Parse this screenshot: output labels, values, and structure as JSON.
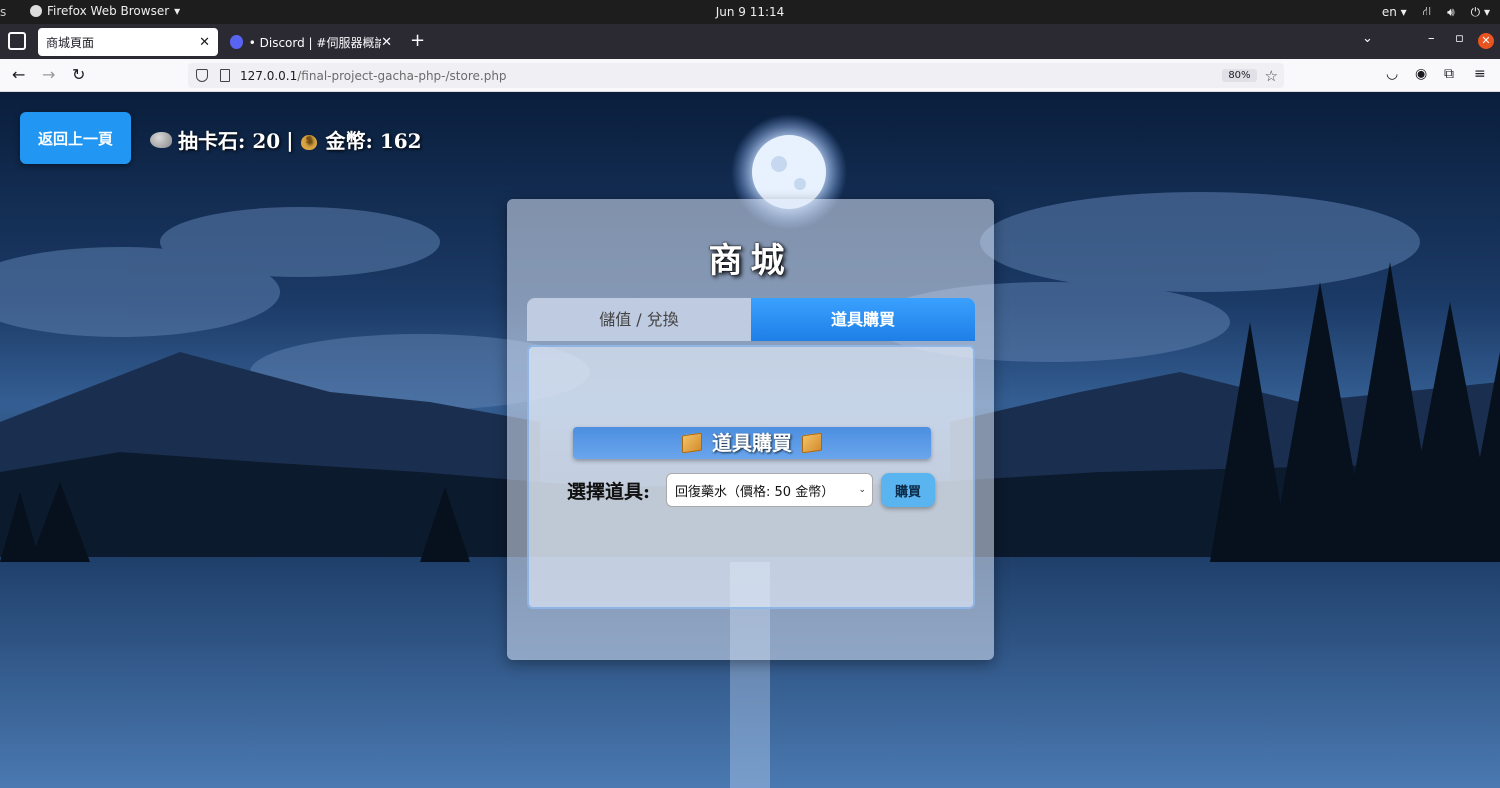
{
  "system_bar": {
    "left_edge": "s",
    "app_name": "Firefox Web Browser",
    "clock": "Jun 9  11:14",
    "language": "en"
  },
  "browser": {
    "tabs": [
      {
        "label": "商城頁面",
        "active": true
      },
      {
        "label": "• Discord | #伺服器概論 |",
        "active": false
      }
    ],
    "url_host": "127.0.0.1",
    "url_path": "/final-project-gacha-php-/store.php",
    "zoom": "80%"
  },
  "header": {
    "back_button": "返回上一頁",
    "stones_label": "抽卡石: 20",
    "separator": "|",
    "coins_label": "金幣: 162"
  },
  "store": {
    "title": "商城",
    "tabs": [
      {
        "label": "儲值 / 兌換",
        "active": false
      },
      {
        "label": "道具購買",
        "active": true
      }
    ],
    "section_title": "道具購買",
    "select_label": "選擇道具:",
    "selected_item": "回復藥水（價格: 50 金幣）",
    "buy_button": "購買"
  },
  "colors": {
    "accent": "#2196f3",
    "tab_active": "#1e7fe6",
    "close_button": "#e95420"
  }
}
